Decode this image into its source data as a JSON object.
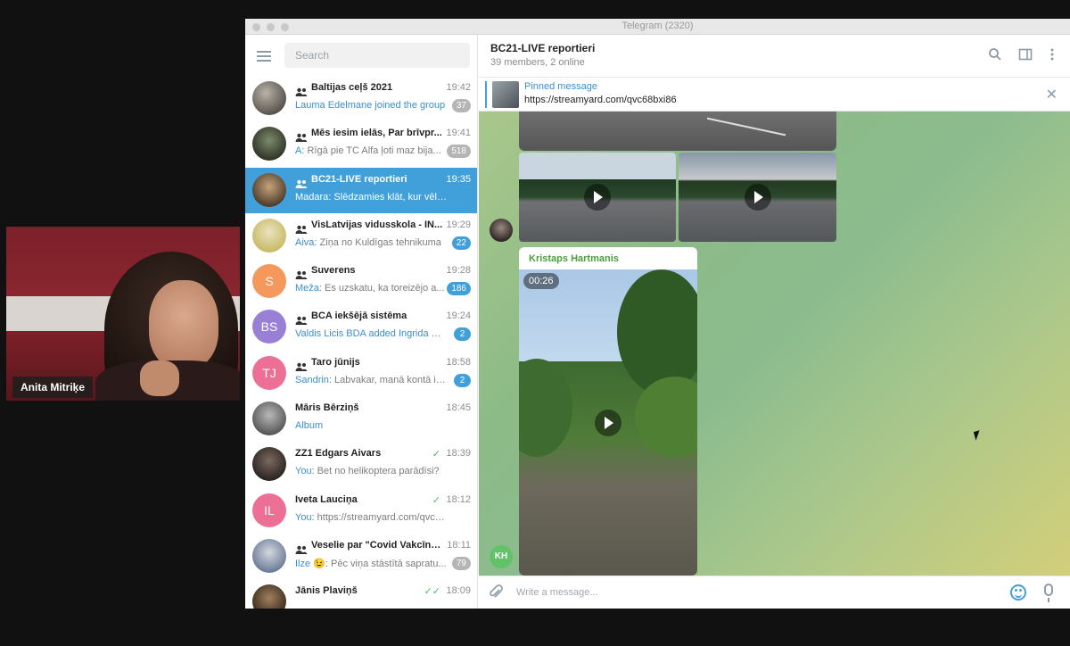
{
  "video_call": {
    "participant_name": "Anita Mitriķe"
  },
  "window": {
    "title": "Telegram (2320)"
  },
  "sidebar": {
    "search_placeholder": "Search",
    "chats": [
      {
        "name": "Baltijas ceļš 2021",
        "time": "19:42",
        "preview_accent": "Lauma Edelmane joined the group",
        "preview": "",
        "badge": "37",
        "badge_style": "muted",
        "group": true
      },
      {
        "name": "Mēs iesim ielās, Par brīvpr...",
        "time": "19:41",
        "preview_accent": "A:",
        "preview": " Rīgā pie TC Alfa ļoti maz bija...",
        "badge": "518",
        "badge_style": "muted",
        "group": true
      },
      {
        "name": "BC21-LIVE reportieri",
        "time": "19:35",
        "preview_accent": "Madara:",
        "preview": " Slēdzamies klāt, kur vēl ir cil...",
        "badge": "",
        "badge_style": "",
        "group": true,
        "active": true
      },
      {
        "name": "VisLatvijas vidusskola - IN...",
        "time": "19:29",
        "preview_accent": "Aiva:",
        "preview": " Ziņa no Kuldīgas tehnikuma",
        "badge": "22",
        "badge_style": "blue",
        "group": true
      },
      {
        "name": "Suverens",
        "time": "19:28",
        "preview_accent": "Meža:",
        "preview": " Es uzskatu, ka toreizējo a...",
        "badge": "186",
        "badge_style": "blue",
        "group": true,
        "initials": "S",
        "color": "#f4985b"
      },
      {
        "name": "BCA iekšējā sistēma",
        "time": "19:24",
        "preview_accent": "Valdis Licis BDA added Ingrida Eli...",
        "preview": "",
        "badge": "2",
        "badge_style": "blue",
        "group": true,
        "initials": "BS",
        "color": "#9a7fd6"
      },
      {
        "name": "Taro jūnijs",
        "time": "18:58",
        "preview_accent": "Sandrin:",
        "preview": " Labvakar, manā kontā ir ...",
        "badge": "2",
        "badge_style": "blue",
        "group": true,
        "initials": "TJ",
        "color": "#ec6f96"
      },
      {
        "name": "Māris Bērziņš",
        "time": "18:45",
        "preview_accent": "Album",
        "preview": "",
        "badge": "",
        "badge_style": "",
        "group": false
      },
      {
        "name": "ZZ1 Edgars Aivars",
        "time": "18:39",
        "preview_accent": "You:",
        "preview": " Bet no helikoptera parādīsi?",
        "badge": "",
        "badge_style": "",
        "group": false,
        "check": "✓"
      },
      {
        "name": "Iveta Lauciņa",
        "time": "18:12",
        "preview_accent": "You:",
        "preview": " https://streamyard.com/qvc68b...",
        "badge": "",
        "badge_style": "",
        "group": false,
        "check": "✓",
        "initials": "IL",
        "color": "#ec6f96"
      },
      {
        "name": "Veselie par \"Covid Vakcīnu...",
        "time": "18:11",
        "preview_accent": "Ilze 😉:",
        "preview": " Pēc viņa stāstītā sapratu...",
        "badge": "79",
        "badge_style": "muted",
        "group": true
      },
      {
        "name": "Jānis Plaviņš",
        "time": "18:09",
        "preview_accent": "",
        "preview": "",
        "badge": "",
        "badge_style": "",
        "group": false,
        "check": "✓✓"
      }
    ]
  },
  "chat_header": {
    "title": "BC21-LIVE reportieri",
    "subtitle": "39 members, 2 online"
  },
  "pinned": {
    "title": "Pinned message",
    "url": "https://streamyard.com/qvc68bxi86"
  },
  "messages": {
    "sender": "Kristaps Hartmanis",
    "video_duration": "00:26",
    "sender_initials": "KH"
  },
  "composer": {
    "placeholder": "Write a message..."
  },
  "icons": {
    "header": [
      "search-icon",
      "sidebar-toggle-icon",
      "more-vertical-icon"
    ],
    "composer": [
      "attach-icon",
      "emoji-icon",
      "microphone-icon"
    ]
  },
  "colors": {
    "accent": "#419fd9",
    "sender_green": "#4aa03c",
    "check_green": "#4dbb5f"
  }
}
